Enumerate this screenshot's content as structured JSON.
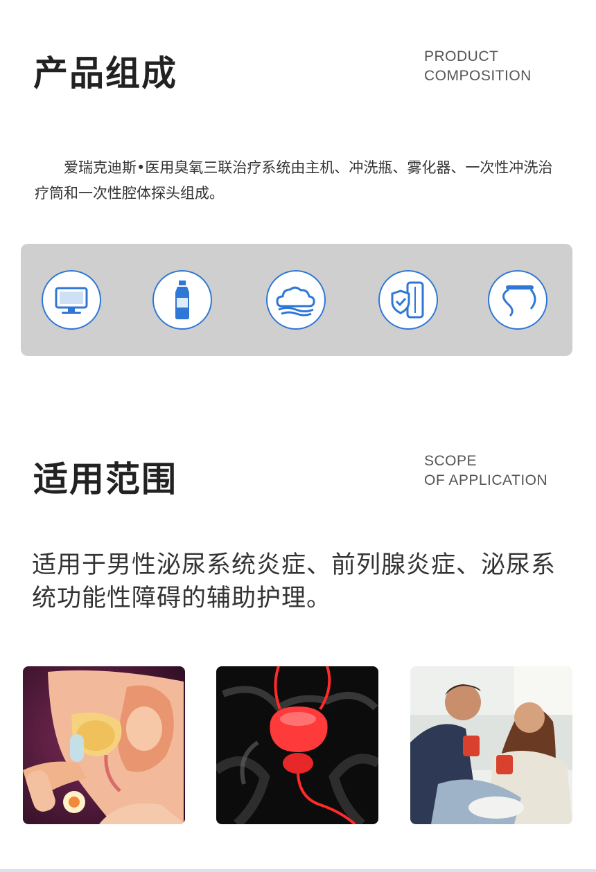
{
  "composition": {
    "title": "产品组成",
    "en_line1": "PRODUCT",
    "en_line2": "COMPOSITION",
    "description": "爱瑞克迪斯•医用臭氧三联治疗系统由主机、冲洗瓶、雾化器、一次性冲洗治疗筒和一次性腔体探头组成。",
    "icons": [
      "monitor-icon",
      "bottle-icon",
      "cloud-mist-icon",
      "treatment-cartridge-icon",
      "probe-tube-icon"
    ],
    "accent_color": "#2f77d6",
    "panel_color": "#cfcfcf"
  },
  "scope": {
    "title": "适用范围",
    "en_line1": "SCOPE",
    "en_line2": "OF APPLICATION",
    "description": "适用于男性泌尿系统炎症、前列腺炎症、泌尿系统功能性障碍的辅助护理。",
    "images": [
      "urinary-anatomy-illustration",
      "prostate-xray-illustration",
      "couple-drinking-photo"
    ]
  }
}
